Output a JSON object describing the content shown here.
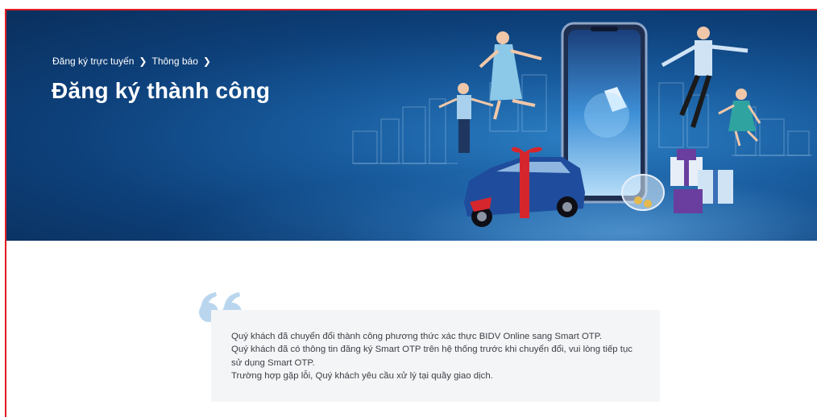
{
  "breadcrumb": {
    "items": [
      "Đăng ký trực tuyến",
      "Thông báo"
    ],
    "separator": "❯"
  },
  "page_title": "Đăng ký thành công",
  "notice": {
    "lines": [
      "Quý khách đã chuyển đổi thành công phương thức xác thực BIDV Online sang Smart OTP.",
      "Quý khách đã có thông tin đăng ký Smart OTP trên hệ thống trước khi chuyển đổi, vui lòng tiếp tục sử dụng Smart OTP.",
      "Trường hợp gặp lỗi, Quý khách yêu cầu xử lý tại quầy giao dịch."
    ]
  },
  "colors": {
    "frame_border": "#e21b23",
    "hero_bg": "#0d3f78",
    "quote_mark": "#b9d6ee",
    "notice_bg": "#f4f5f7"
  },
  "icons": {
    "breadcrumb_separator": "chevron-right-icon",
    "quote": "quote-icon"
  }
}
